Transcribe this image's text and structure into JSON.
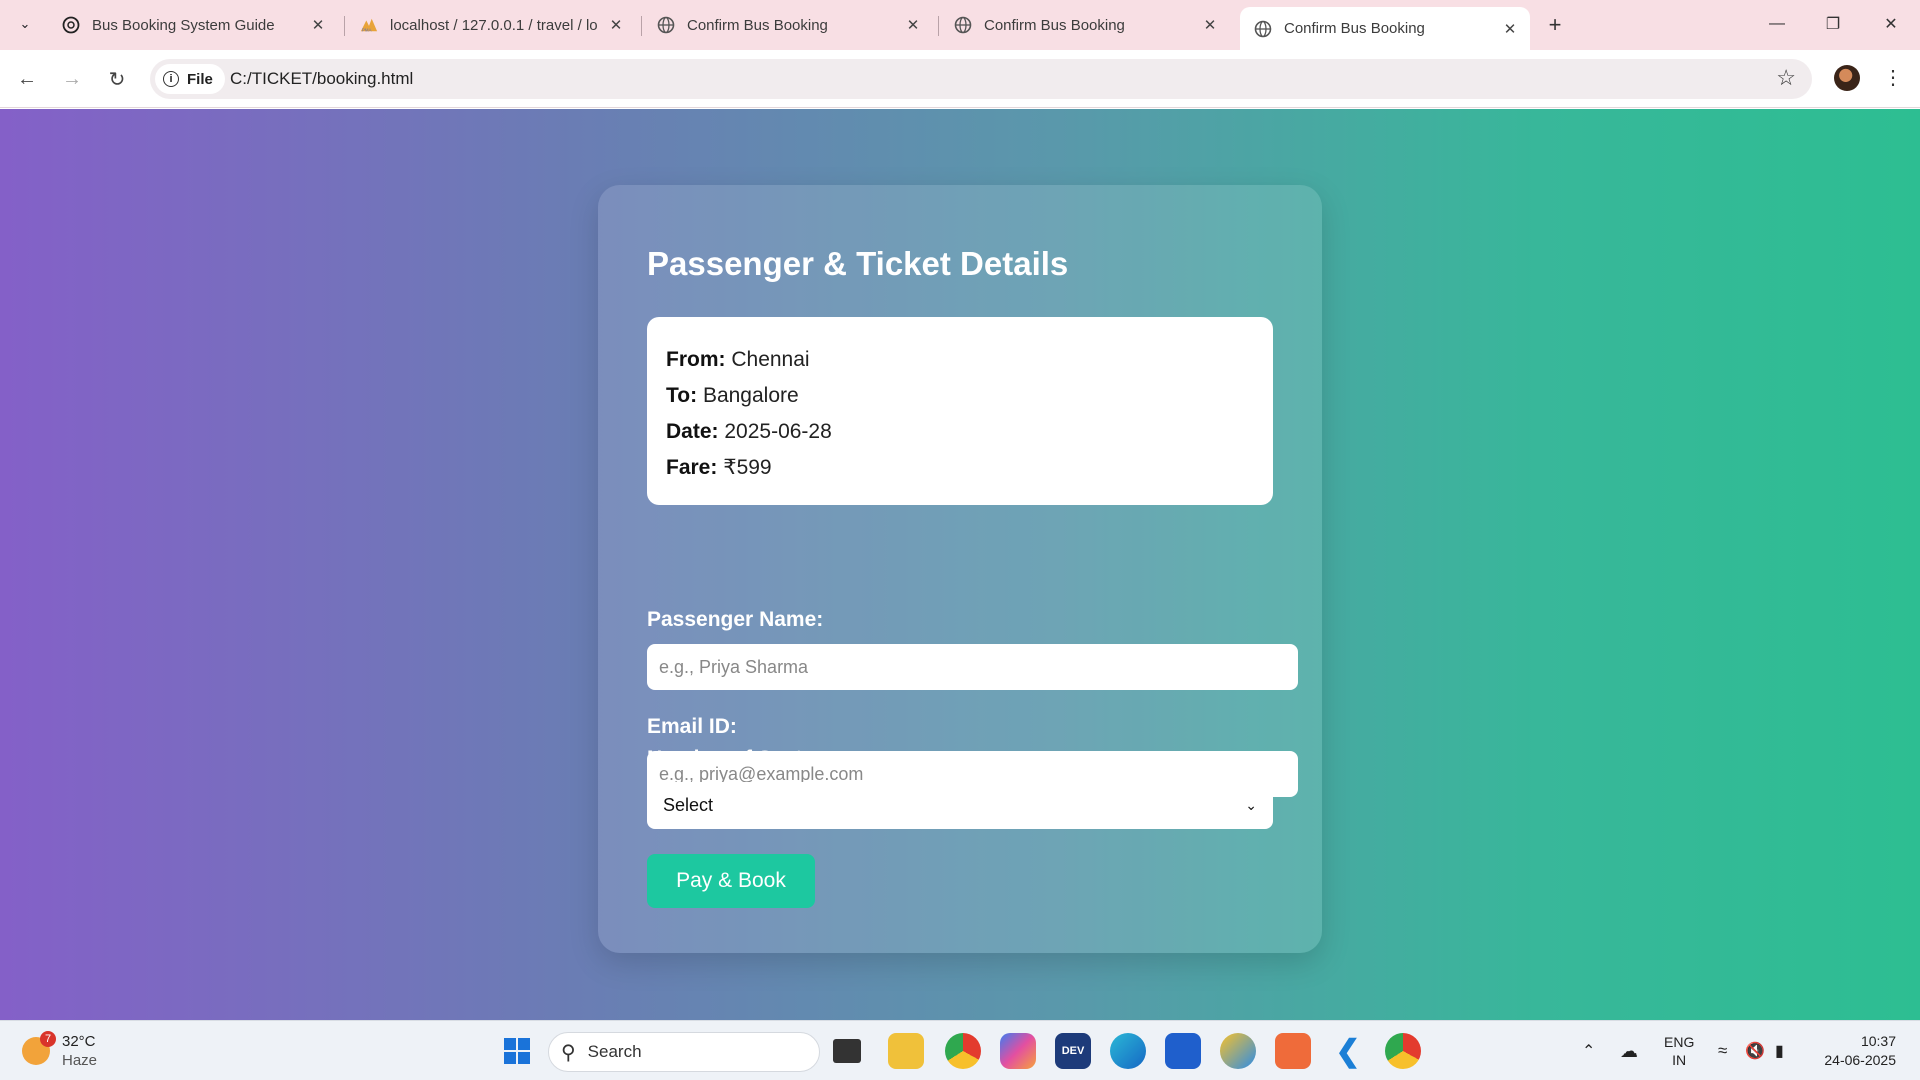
{
  "browser": {
    "tabs": [
      {
        "title": "Bus Booking System Guide",
        "icon": "openai-icon"
      },
      {
        "title": "localhost / 127.0.0.1 / travel / lo",
        "icon": "phpmyadmin-icon"
      },
      {
        "title": "Confirm Bus Booking",
        "icon": "globe-icon"
      },
      {
        "title": "Confirm Bus Booking",
        "icon": "globe-icon"
      },
      {
        "title": "Confirm Bus Booking",
        "icon": "globe-icon",
        "active": true
      }
    ],
    "url_scheme_label": "File",
    "url": "C:/TICKET/booking.html"
  },
  "page": {
    "title": "Passenger & Ticket Details",
    "details": [
      {
        "label": "From:",
        "value": "Chennai"
      },
      {
        "label": "To:",
        "value": "Bangalore"
      },
      {
        "label": "Date:",
        "value": "2025-06-28"
      },
      {
        "label": "Fare:",
        "value": "₹599"
      }
    ],
    "name_label": "Passenger Name:",
    "name_placeholder": "e.g., Priya Sharma",
    "email_label": "Email ID:",
    "email_placeholder": "e.g., priya@example.com",
    "seats_label": "Number of Seats:",
    "seats_selected": "Select",
    "submit_label": "Pay & Book",
    "colors": {
      "button": "#1dc8a0",
      "gradient_start": "#8460c8",
      "gradient_end": "#2dbe92"
    }
  },
  "taskbar": {
    "weather_temp": "32°C",
    "weather_desc": "Haze",
    "weather_badge": "7",
    "search_label": "Search",
    "lang_line1": "ENG",
    "lang_line2": "IN",
    "time": "10:37",
    "date": "24-06-2025"
  }
}
